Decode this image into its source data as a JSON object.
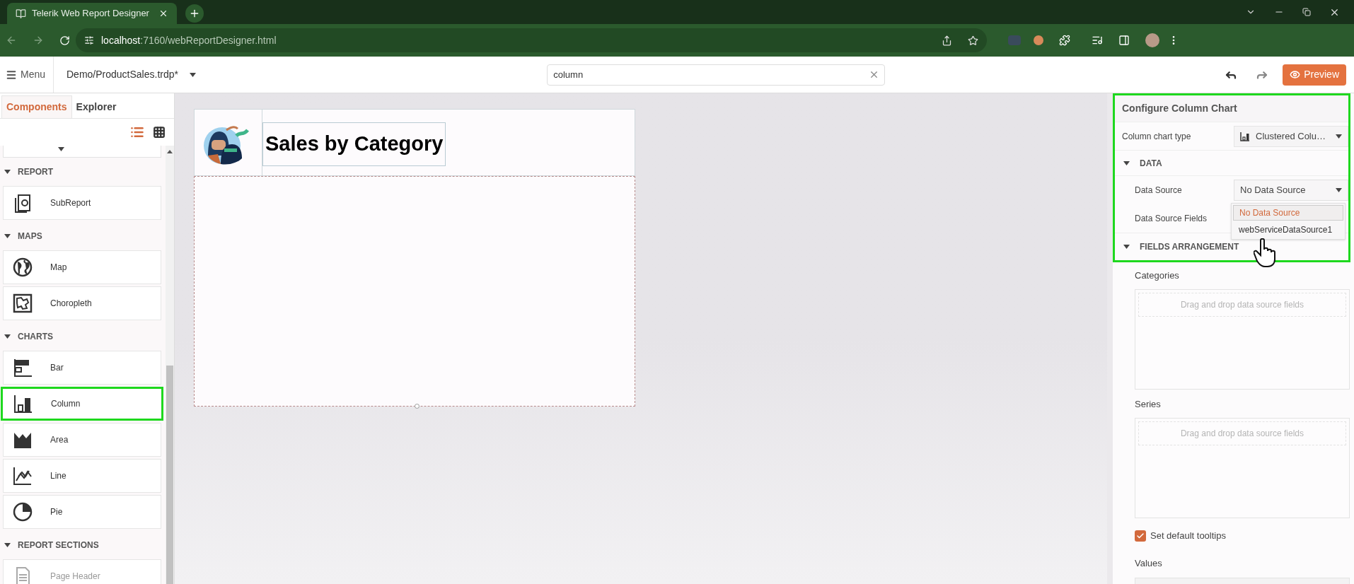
{
  "browser": {
    "tab_title": "Telerik Web Report Designer",
    "url_host": "localhost",
    "url_path": ":7160/webReportDesigner.html"
  },
  "toolbar": {
    "menu_label": "Menu",
    "file_name": "Demo/ProductSales.trdp*",
    "search_value": "column",
    "preview_label": "Preview"
  },
  "left_panel": {
    "tabs": [
      {
        "label": "Components",
        "selected": true
      },
      {
        "label": "Explorer",
        "selected": false
      }
    ],
    "views": [
      {
        "kind": "list",
        "selected": true
      },
      {
        "kind": "grid",
        "selected": false
      }
    ],
    "sections": [
      {
        "title": "REPORT",
        "expanded": true,
        "items": [
          {
            "label": "SubReport",
            "kind": "subreport",
            "highlighted": false,
            "disabled": false
          }
        ]
      },
      {
        "title": "MAPS",
        "expanded": true,
        "items": [
          {
            "label": "Map",
            "kind": "map",
            "highlighted": false,
            "disabled": false
          },
          {
            "label": "Choropleth",
            "kind": "choropleth",
            "highlighted": false,
            "disabled": false
          }
        ]
      },
      {
        "title": "CHARTS",
        "expanded": true,
        "items": [
          {
            "label": "Bar",
            "kind": "bar",
            "highlighted": false,
            "disabled": false
          },
          {
            "label": "Column",
            "kind": "column",
            "highlighted": true,
            "disabled": false
          },
          {
            "label": "Area",
            "kind": "area",
            "highlighted": false,
            "disabled": false
          },
          {
            "label": "Line",
            "kind": "line",
            "highlighted": false,
            "disabled": false
          },
          {
            "label": "Pie",
            "kind": "pie",
            "highlighted": false,
            "disabled": false
          }
        ]
      },
      {
        "title": "REPORT SECTIONS",
        "expanded": true,
        "items": [
          {
            "label": "Page Header",
            "kind": "page-header",
            "highlighted": false,
            "disabled": true
          }
        ]
      }
    ]
  },
  "report": {
    "title": "Sales by Category"
  },
  "config": {
    "title": "Configure Column Chart",
    "highlighted": true,
    "chart_type": {
      "label": "Column chart type",
      "value": "Clustered Colu…"
    },
    "data": {
      "title": "DATA",
      "expanded": true,
      "source_label": "Data Source",
      "source_value": "No Data Source",
      "fields_label": "Data Source Fields",
      "options": [
        {
          "label": "No Data Source",
          "selected": true
        },
        {
          "label": "webServiceDataSource1",
          "selected": false
        }
      ]
    },
    "arrangement": {
      "title": "FIELDS ARRANGEMENT",
      "expanded": true,
      "zones": [
        {
          "label": "Categories",
          "placeholder": "Drag and drop data source fields"
        },
        {
          "label": "Series",
          "placeholder": "Drag and drop data source fields"
        }
      ],
      "tooltips": {
        "label": "Set default tooltips",
        "checked": true
      },
      "values_label": "Values"
    }
  }
}
